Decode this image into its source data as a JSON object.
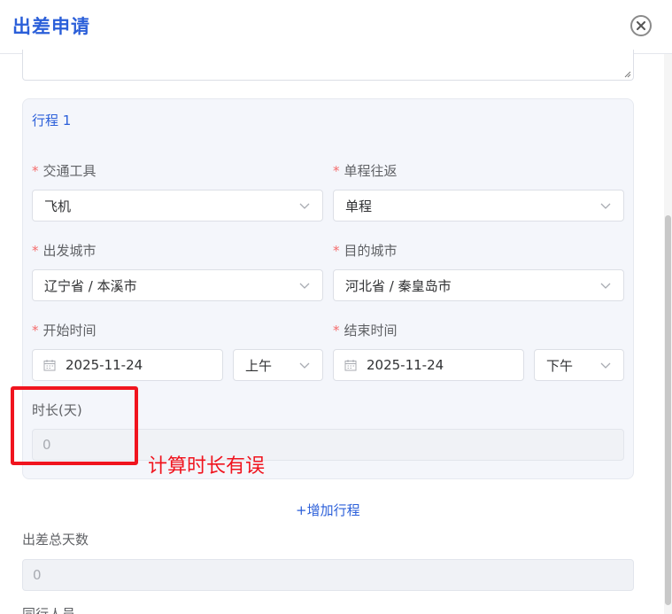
{
  "dialog": {
    "title": "出差申请"
  },
  "itinerary": {
    "title": "行程 1",
    "transport": {
      "label": "交通工具",
      "value": "飞机"
    },
    "trip_type": {
      "label": "单程往返",
      "value": "单程"
    },
    "departure_city": {
      "label": "出发城市",
      "value": "辽宁省 / 本溪市"
    },
    "destination_city": {
      "label": "目的城市",
      "value": "河北省 / 秦皇岛市"
    },
    "start_time": {
      "label": "开始时间",
      "date": "2025-11-24",
      "period": "上午"
    },
    "end_time": {
      "label": "结束时间",
      "date": "2025-11-24",
      "period": "下午"
    },
    "duration": {
      "label": "时长(天)",
      "value": "0"
    }
  },
  "annotation": {
    "text": "计算时长有误"
  },
  "add_itinerary_label": "+增加行程",
  "total_days": {
    "label": "出差总天数",
    "value": "0"
  },
  "next_label": "同行人员"
}
